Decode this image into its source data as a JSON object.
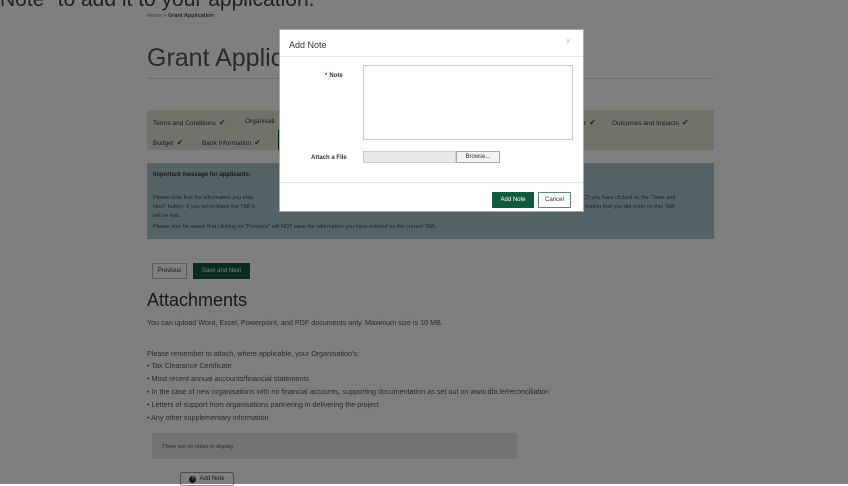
{
  "top_caption": "Note\" to add it to your application.",
  "breadcrumb": {
    "home": "Home",
    "sep": ">",
    "current": "Grant Application"
  },
  "page_title": "Grant Applica",
  "tabs": [
    {
      "label": "Terms and Conditions"
    },
    {
      "label": "Organisati"
    },
    {
      "label": "Outcomes and Impacts"
    },
    {
      "label": "Budget"
    },
    {
      "label": "Bank Information"
    }
  ],
  "check_glyph": "✔",
  "message": {
    "title": "Important message for applicants:",
    "line1_left": "Please note that the information you ente",
    "line1_right": "(2) you have clicked on the \"Save and",
    "line2_left": "Next\" button. If you opt to leave the TAB b",
    "line2_right": "rmation that you did enter on this TAB",
    "line3": "will be lost.",
    "line4": "Please also be aware that clicking on \"Previous\" will NOT save the information you have entered on the current TAB."
  },
  "buttons": {
    "previous": "Previous",
    "save_next": "Save and Next"
  },
  "attachments": {
    "title": "Attachments",
    "intro": "You can upload Word, Excel, Powerpoint, and PDF documents only. Maximum size is 10 MB.",
    "reminder": "Please remember to attach, where applicable, your Organisation's:",
    "items": [
      "• Tax Clearance Certificate",
      "• Most recent annual accounts/financial statements",
      "• In the case of new organisations with no financial accounts, supporting documentation as set out on www.dfa.ie/reconciliation",
      "• Letters of support from organisations partnering in delivering the project",
      "• Any other supplementary information"
    ],
    "no_notes": "There are no notes to display.",
    "add_note": "Add Note"
  },
  "modal": {
    "title": "Add Note",
    "close": "×",
    "note_label": "Note",
    "required_mark": "*",
    "note_value": "",
    "attach_label": "Attach a File",
    "browse": "Browse...",
    "add_note": "Add Note",
    "cancel": "Cancel"
  },
  "colors": {
    "primary": "#0f5c3a",
    "tabs_bg": "#dfe6d5",
    "message_bg": "#a9c6cc"
  }
}
